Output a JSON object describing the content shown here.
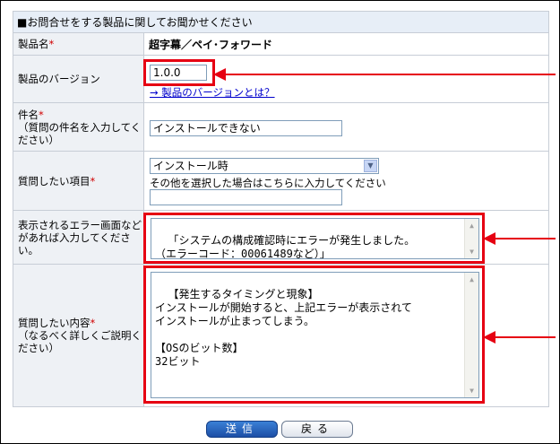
{
  "section": {
    "title": "■お問合せをする製品に関してお聞かせください"
  },
  "product_name": {
    "label": "製品名",
    "value": "超字幕／ペイ･フォワード"
  },
  "product_version": {
    "label": "製品のバージョン",
    "value": "1.0.0",
    "help_link": "→ 製品のバージョンとは？"
  },
  "subject": {
    "label_line1": "件名",
    "label_rest": "（質問の件名を入力してください）",
    "value": "インストールできない"
  },
  "question_item": {
    "label": "質問したい項目",
    "selected": "インストール時",
    "other_hint": "その他を選択した場合はこちらに入力してください",
    "other_value": ""
  },
  "error_screen": {
    "label": "表示されるエラー画面などがあれば入力してください。",
    "value": "「システムの構成確認時にエラーが発生しました。\n（エラーコード：00061489など）」"
  },
  "question_content": {
    "label_line1": "質問したい内容",
    "label_rest": "（なるべく詳しくご説明ください）",
    "value": "【発生するタイミングと現象】\nインストールが開始すると、上記エラーが表示されて\nインストールが止まってしまう。\n\n【OSのビット数】\n32ビット"
  },
  "required_mark": "*",
  "buttons": {
    "submit": "送信",
    "back": "戻る"
  },
  "colors": {
    "highlight": "#e60012",
    "header_bg": "#e7eef7",
    "label_bg": "#eef1f5",
    "link": "#0000cc"
  },
  "icons": {
    "select_arrow": "chevron-down-icon",
    "scroll_up": "scroll-up-icon",
    "scroll_down": "scroll-down-icon"
  }
}
